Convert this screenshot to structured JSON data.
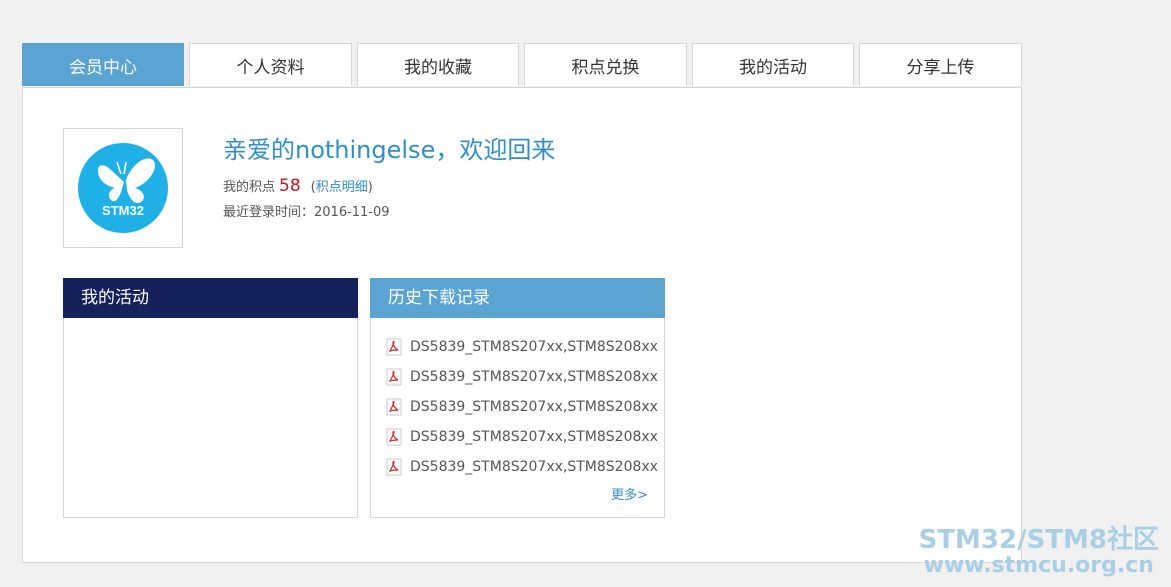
{
  "tabs": [
    {
      "label": "会员中心",
      "active": true
    },
    {
      "label": "个人资料",
      "active": false
    },
    {
      "label": "我的收藏",
      "active": false
    },
    {
      "label": "积点兑换",
      "active": false
    },
    {
      "label": "我的活动",
      "active": false
    },
    {
      "label": "分享上传",
      "active": false
    }
  ],
  "profile": {
    "avatar_text": "STM32",
    "welcome": "亲爱的nothingelse，欢迎回来",
    "points_label": "我的积点",
    "points_value": "58",
    "points_open": "(",
    "points_link": "积点明细",
    "points_close": ")",
    "last_login": "最近登录时间：2016-11-09"
  },
  "activities": {
    "title": "我的活动"
  },
  "downloads": {
    "title": "历史下载记录",
    "items": [
      "DS5839_STM8S207xx,STM8S208xx",
      "DS5839_STM8S207xx,STM8S208xx",
      "DS5839_STM8S207xx,STM8S208xx",
      "DS5839_STM8S207xx,STM8S208xx",
      "DS5839_STM8S207xx,STM8S208xx"
    ],
    "more": "更多>"
  },
  "watermark": {
    "line1": "STM32/STM8社区",
    "line2": "www.stmcu.org.cn"
  },
  "colors": {
    "accent": "#5ba3d1",
    "link": "#2f8fc6",
    "dark_header": "#14215a",
    "points": "#c0151b"
  }
}
